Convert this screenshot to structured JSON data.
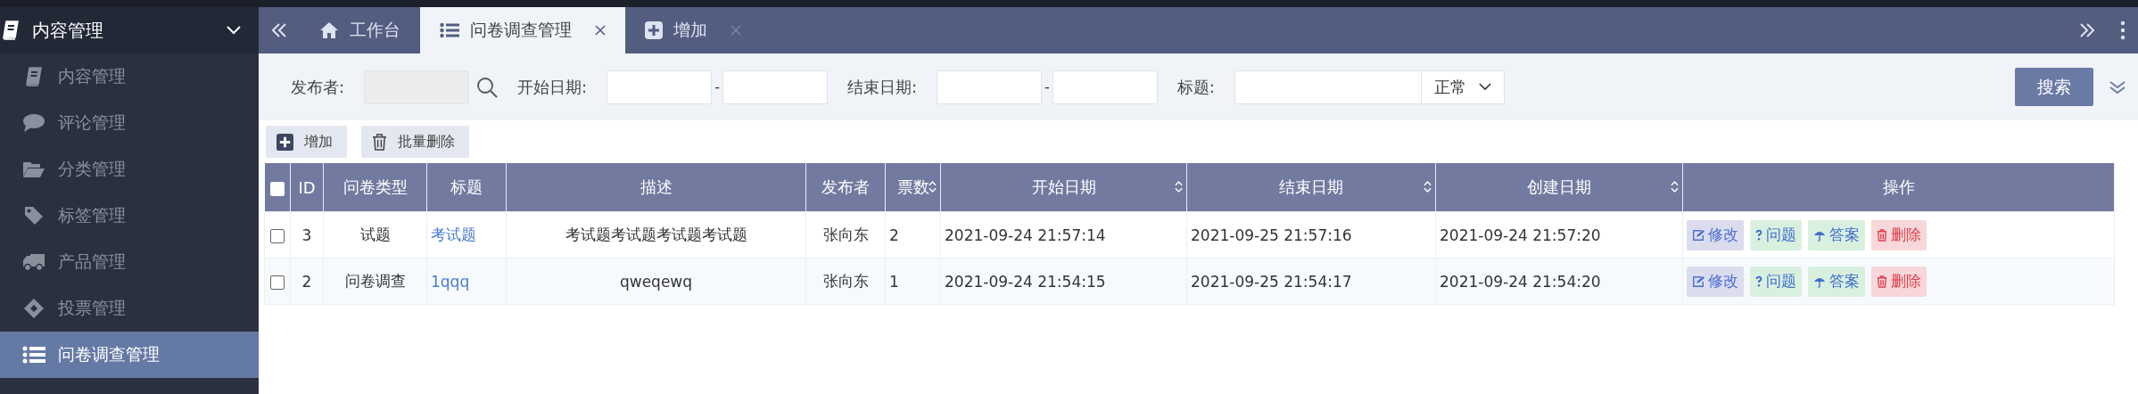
{
  "sidebar": {
    "group": {
      "label": "内容管理",
      "expanded": true
    },
    "items": [
      {
        "label": "内容管理",
        "selected": false
      },
      {
        "label": "评论管理",
        "selected": false
      },
      {
        "label": "分类管理",
        "selected": false
      },
      {
        "label": "标签管理",
        "selected": false
      },
      {
        "label": "产品管理",
        "selected": false
      },
      {
        "label": "投票管理",
        "selected": false
      },
      {
        "label": "问卷调查管理",
        "selected": true
      }
    ]
  },
  "tabs": [
    {
      "label": "工作台",
      "selected": false,
      "closable": false
    },
    {
      "label": "问卷调查管理",
      "selected": true,
      "closable": true
    },
    {
      "label": "增加",
      "selected": false,
      "closable": true
    }
  ],
  "filters": {
    "publisher_label": "发布者:",
    "start_label": "开始日期:",
    "range_separator_1": "-",
    "end_label": "结束日期:",
    "range_separator_2": "-",
    "title_label": "标题:",
    "status_select": "正常",
    "search_button": "搜索"
  },
  "toolbar": [
    "增加",
    "批量删除"
  ],
  "table": {
    "all_checked": false,
    "columns": [
      {
        "label": "ID",
        "sortable": false
      },
      {
        "label": "问卷类型",
        "sortable": false
      },
      {
        "label": "标题",
        "sortable": false
      },
      {
        "label": "描述",
        "sortable": false
      },
      {
        "label": "发布者",
        "sortable": false
      },
      {
        "label": "票数",
        "sortable": true
      },
      {
        "label": "开始日期",
        "sortable": true
      },
      {
        "label": "结束日期",
        "sortable": true
      },
      {
        "label": "创建日期",
        "sortable": true
      },
      {
        "label": "操作",
        "sortable": false
      }
    ],
    "rows": [
      {
        "checked": false,
        "id": "3",
        "type": "试题",
        "title": "考试题",
        "description": "考试题考试题考试题考试题",
        "publisher": "张向东",
        "votes": "2",
        "start": "2021-09-24 21:57:14",
        "end": "2021-09-25 21:57:16",
        "created": "2021-09-24 21:57:20",
        "actions": [
          {
            "kind": "edit",
            "label": "修改"
          },
          {
            "kind": "question",
            "label": "问题"
          },
          {
            "kind": "answer",
            "label": "答案"
          },
          {
            "kind": "delete",
            "label": "删除"
          }
        ]
      },
      {
        "checked": false,
        "id": "2",
        "type": "问卷调查",
        "title": "1qqq",
        "description": "qweqewq",
        "publisher": "张向东",
        "votes": "1",
        "start": "2021-09-24 21:54:15",
        "end": "2021-09-25 21:54:17",
        "created": "2021-09-24 21:54:20",
        "actions": [
          {
            "kind": "edit",
            "label": "修改"
          },
          {
            "kind": "question",
            "label": "问题"
          },
          {
            "kind": "answer",
            "label": "答案"
          },
          {
            "kind": "delete",
            "label": "删除"
          }
        ]
      }
    ]
  }
}
